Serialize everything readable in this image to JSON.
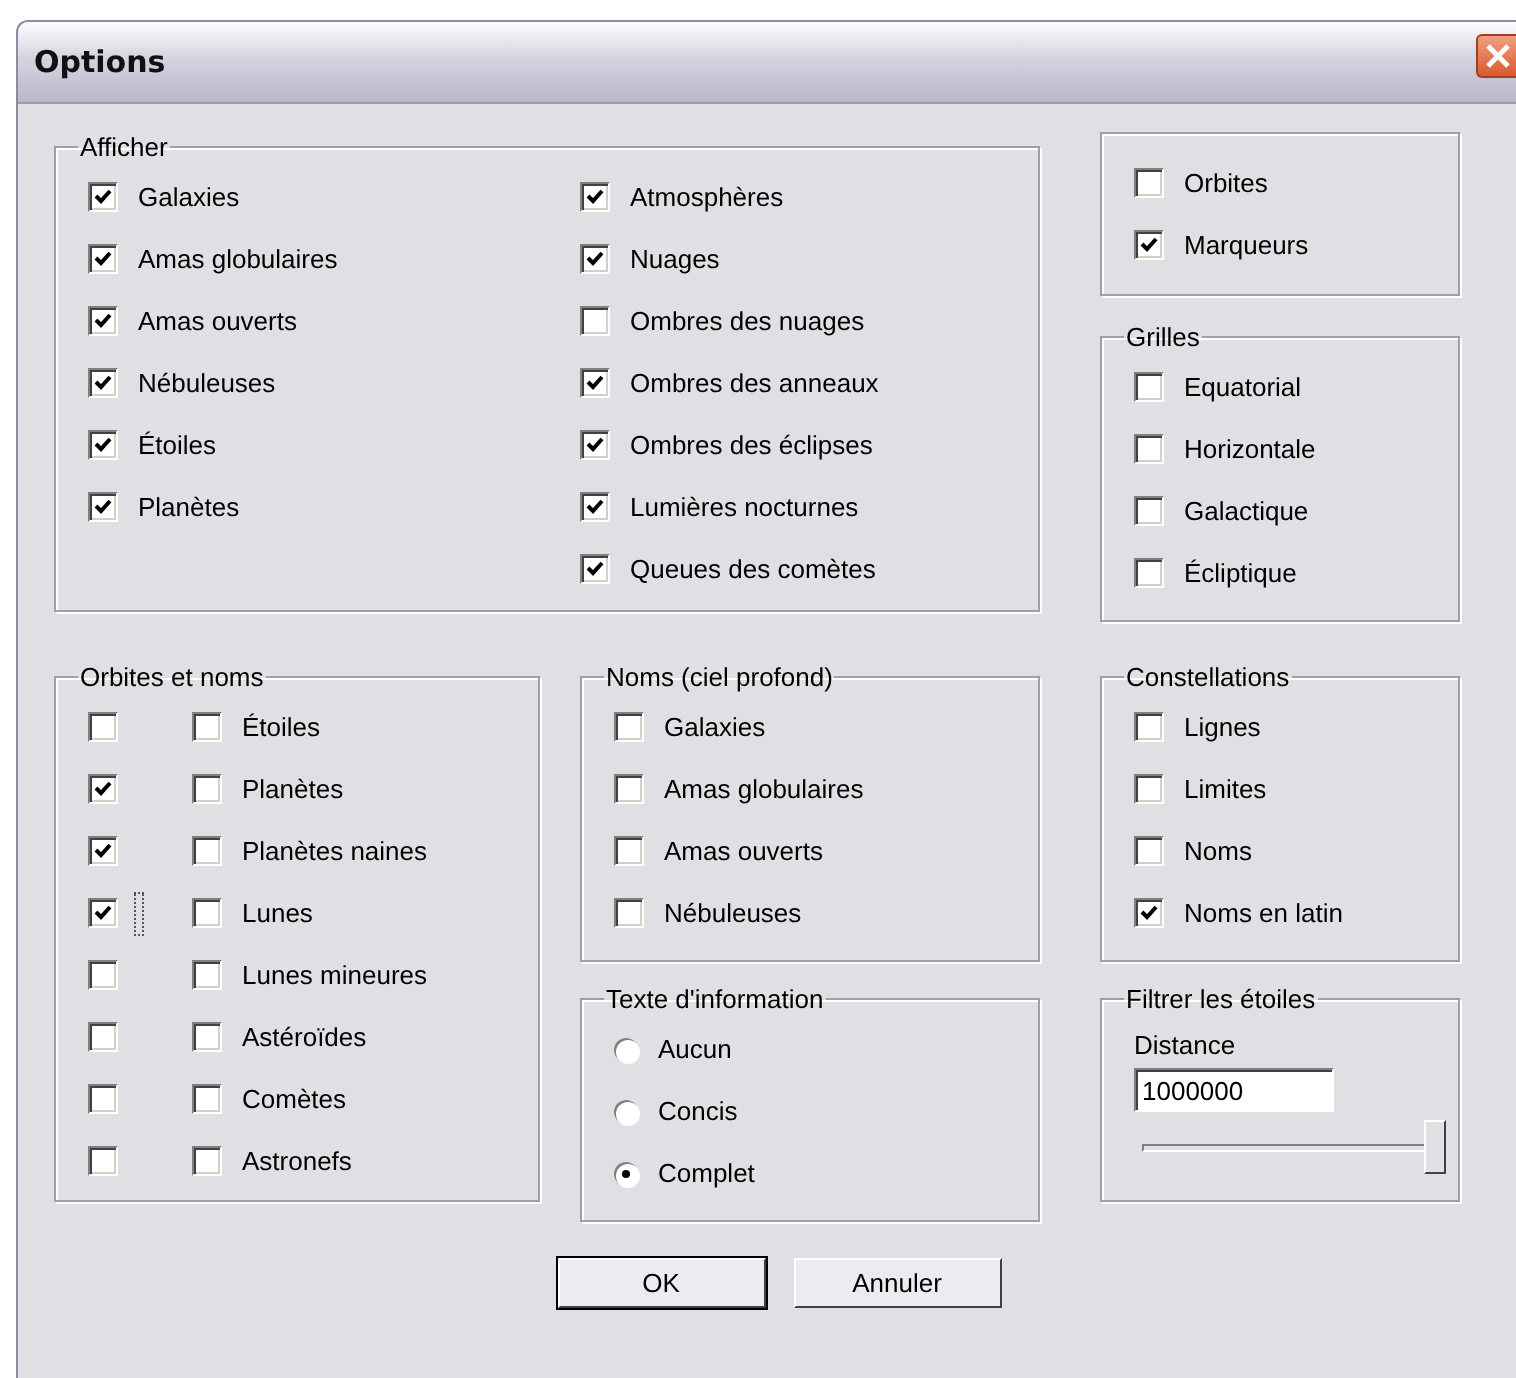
{
  "window": {
    "title": "Options"
  },
  "afficher": {
    "title": "Afficher",
    "columns": [
      [
        {
          "label": "Galaxies",
          "checked": true
        },
        {
          "label": "Amas globulaires",
          "checked": true
        },
        {
          "label": "Amas ouverts",
          "checked": true
        },
        {
          "label": "Nébuleuses",
          "checked": true
        },
        {
          "label": "Étoiles",
          "checked": true
        },
        {
          "label": "Planètes",
          "checked": true
        }
      ],
      [
        {
          "label": "Atmosphères",
          "checked": true
        },
        {
          "label": "Nuages",
          "checked": true
        },
        {
          "label": "Ombres des nuages",
          "checked": false
        },
        {
          "label": "Ombres des anneaux",
          "checked": true
        },
        {
          "label": "Ombres des éclipses",
          "checked": true
        },
        {
          "label": "Lumières nocturnes",
          "checked": true
        },
        {
          "label": "Queues des comètes",
          "checked": true
        }
      ]
    ]
  },
  "marqueurs": {
    "items": [
      {
        "label": "Orbites",
        "checked": false
      },
      {
        "label": "Marqueurs",
        "checked": true
      }
    ]
  },
  "grilles": {
    "title": "Grilles",
    "items": [
      {
        "label": "Equatorial",
        "checked": false
      },
      {
        "label": "Horizontale",
        "checked": false
      },
      {
        "label": "Galactique",
        "checked": false
      },
      {
        "label": "Écliptique",
        "checked": false
      }
    ]
  },
  "orbites_et_noms": {
    "title": "Orbites et noms",
    "rows": [
      {
        "label": "Étoiles",
        "orbit_checked": false,
        "name_checked": false,
        "focused": false
      },
      {
        "label": "Planètes",
        "orbit_checked": true,
        "name_checked": false,
        "focused": false
      },
      {
        "label": "Planètes naines",
        "orbit_checked": true,
        "name_checked": false,
        "focused": false
      },
      {
        "label": "Lunes",
        "orbit_checked": true,
        "name_checked": false,
        "focused": true
      },
      {
        "label": "Lunes mineures",
        "orbit_checked": false,
        "name_checked": false,
        "focused": false
      },
      {
        "label": "Astéroïdes",
        "orbit_checked": false,
        "name_checked": false,
        "focused": false
      },
      {
        "label": "Comètes",
        "orbit_checked": false,
        "name_checked": false,
        "focused": false
      },
      {
        "label": "Astronefs",
        "orbit_checked": false,
        "name_checked": false,
        "focused": false
      }
    ]
  },
  "noms_ciel_profond": {
    "title": "Noms (ciel profond)",
    "items": [
      {
        "label": "Galaxies",
        "checked": false
      },
      {
        "label": "Amas globulaires",
        "checked": false
      },
      {
        "label": "Amas ouverts",
        "checked": false
      },
      {
        "label": "Nébuleuses",
        "checked": false
      }
    ]
  },
  "texte_information": {
    "title": "Texte d'information",
    "options": [
      {
        "label": "Aucun",
        "selected": false
      },
      {
        "label": "Concis",
        "selected": false
      },
      {
        "label": "Complet",
        "selected": true
      }
    ]
  },
  "constellations": {
    "title": "Constellations",
    "items": [
      {
        "label": "Lignes",
        "checked": false
      },
      {
        "label": "Limites",
        "checked": false
      },
      {
        "label": "Noms",
        "checked": false
      },
      {
        "label": "Noms en latin",
        "checked": true
      }
    ]
  },
  "filtrer_etoiles": {
    "title": "Filtrer les étoiles",
    "distance_label": "Distance",
    "distance_value": "1000000",
    "slider": {
      "level": 1.0
    }
  },
  "buttons": [
    {
      "label": "OK",
      "default": true
    },
    {
      "label": "Annuler",
      "default": false
    }
  ]
}
